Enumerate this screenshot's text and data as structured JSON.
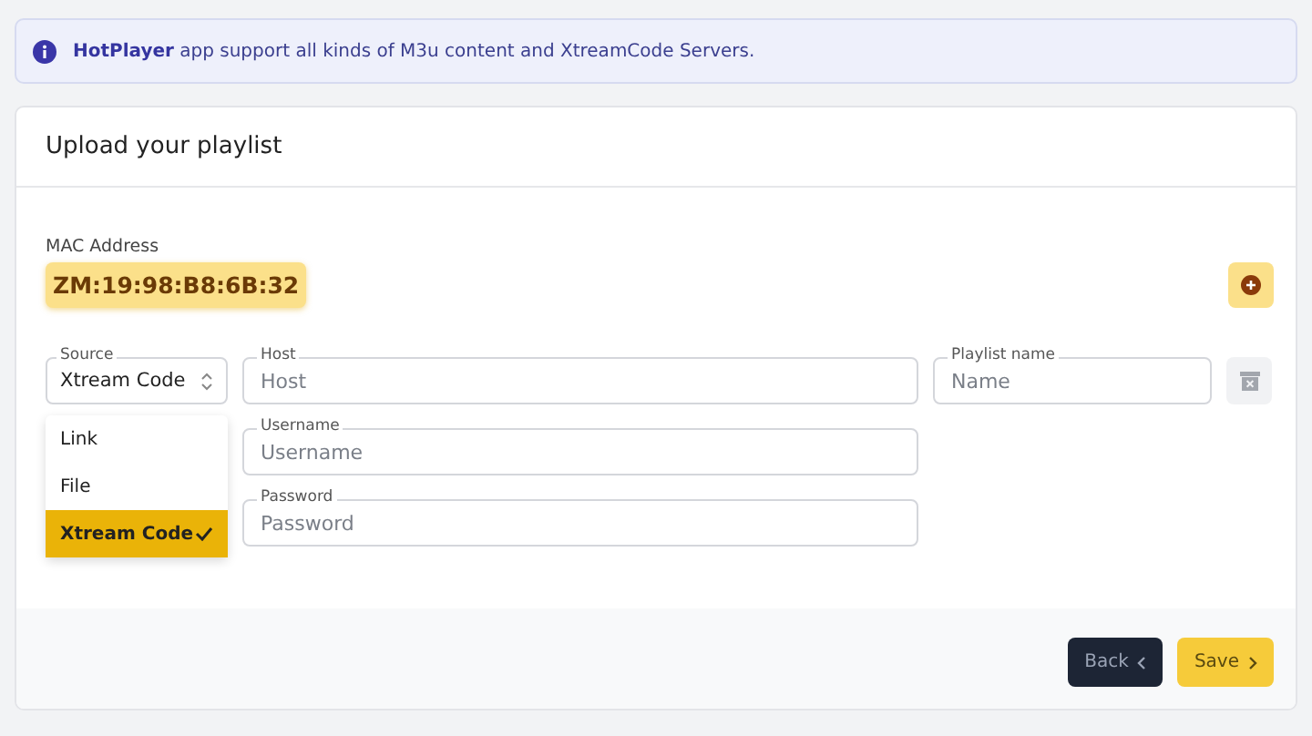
{
  "banner": {
    "text": "**HotPlayer** app support all kinds of M3u content and XtreamCode Servers."
  },
  "card": {
    "title": "Upload your playlist"
  },
  "mac": {
    "label": "MAC Address",
    "value": "ZM:19:98:B8:6B:32"
  },
  "source": {
    "label": "Source",
    "value": "Xtream Code",
    "expanded": true,
    "options": [
      {
        "label": "Link",
        "selected": false
      },
      {
        "label": "File",
        "selected": false
      },
      {
        "label": "Xtream Code",
        "selected": true
      }
    ]
  },
  "fields": [
    {
      "label": "Host",
      "placeholder": "Host"
    },
    {
      "label": "Username",
      "placeholder": "Username"
    },
    {
      "label": "Password",
      "placeholder": "Password"
    }
  ],
  "playlist_name": {
    "label": "Playlist name",
    "placeholder": "Name"
  },
  "buttons": [
    {
      "label": "Back",
      "kind": "back"
    },
    {
      "label": "Save",
      "kind": "save"
    }
  ]
}
